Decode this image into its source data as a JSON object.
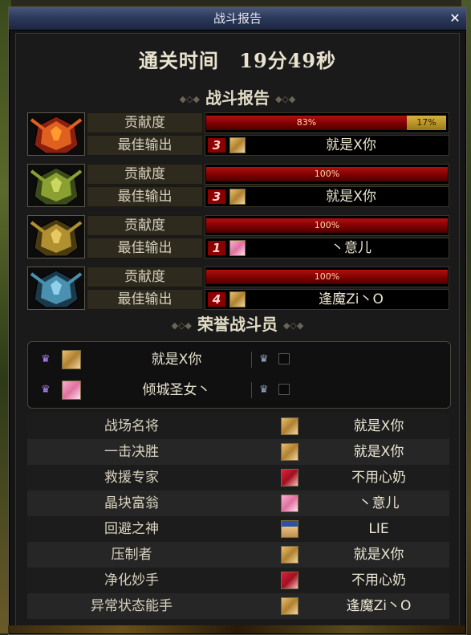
{
  "window": {
    "title": "战斗报告",
    "close_icon": "close-icon"
  },
  "clear_time": {
    "label": "通关时间",
    "value": "19分49秒"
  },
  "section_battle_report": "战斗报告",
  "section_honor": "荣誉战斗员",
  "report_labels": {
    "contribution": "贡献度",
    "best_output": "最佳输出"
  },
  "reports": [
    {
      "boss_icon": "red-boss-icon",
      "bar": [
        {
          "label": "83%",
          "value": 83,
          "color": "#a01010"
        },
        {
          "label": "17%",
          "value": 17,
          "color": "#c8a030"
        }
      ],
      "rank": "3",
      "face": "blonde-face",
      "player": "就是X你"
    },
    {
      "boss_icon": "green-boss-icon",
      "bar": [
        {
          "label": "100%",
          "value": 100,
          "color": "#a01010"
        }
      ],
      "rank": "3",
      "face": "blonde-face",
      "player": "就是X你"
    },
    {
      "boss_icon": "gold-boss-icon",
      "bar": [
        {
          "label": "100%",
          "value": 100,
          "color": "#a01010"
        }
      ],
      "rank": "1",
      "face": "pink-hair-face",
      "player": "丶意儿"
    },
    {
      "boss_icon": "blue-boss-icon",
      "bar": [
        {
          "label": "100%",
          "value": 100,
          "color": "#a01010"
        }
      ],
      "rank": "4",
      "face": "blonde-face",
      "player": "逢魔Zi丶O"
    }
  ],
  "honor": [
    {
      "icon": "crown-purple-icon",
      "face": "blonde-face",
      "name": "就是X你"
    },
    {
      "icon": "crown-purple-icon",
      "face": "pink-hair-face",
      "name": "倾城圣女丶"
    }
  ],
  "awards": [
    {
      "title": "战场名将",
      "face": "blonde-face",
      "name": "就是X你"
    },
    {
      "title": "一击决胜",
      "face": "blonde-face",
      "name": "就是X你"
    },
    {
      "title": "救援专家",
      "face": "red-hair-face",
      "name": "不用心奶"
    },
    {
      "title": "晶块富翁",
      "face": "pink-hair-face",
      "name": "丶意儿"
    },
    {
      "title": "回避之神",
      "face": "blue-headband-face",
      "name": "LIE"
    },
    {
      "title": "压制者",
      "face": "blonde-face",
      "name": "就是X你"
    },
    {
      "title": "净化妙手",
      "face": "red-hair-face",
      "name": "不用心奶"
    },
    {
      "title": "异常状态能手",
      "face": "blonde-face",
      "name": "逢魔Zi丶O"
    }
  ]
}
